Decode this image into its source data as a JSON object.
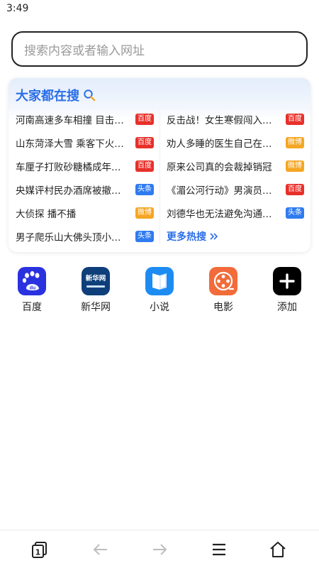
{
  "status_bar": {
    "time": "3:49"
  },
  "search": {
    "placeholder": "搜索内容或者输入网址"
  },
  "hot_search": {
    "title": "大家都在搜",
    "more_label": "更多热搜",
    "left_items": [
      {
        "text": "河南高速多车相撞 目击…",
        "badge": "百度",
        "badge_color": "#e8302a"
      },
      {
        "text": "山东菏泽大雪 乘客下火…",
        "badge": "百度",
        "badge_color": "#e8302a"
      },
      {
        "text": "车厘子打败砂糖橘成年…",
        "badge": "百度",
        "badge_color": "#e8302a"
      },
      {
        "text": "央媒评村民办酒席被撤…",
        "badge": "头条",
        "badge_color": "#2f7bf0"
      },
      {
        "text": "大侦探 播不播",
        "badge": "微博",
        "badge_color": "#f5a623"
      },
      {
        "text": "男子爬乐山大佛头顶小…",
        "badge": "头条",
        "badge_color": "#2f7bf0"
      }
    ],
    "right_items": [
      {
        "text": "反击战！女生寒假闯入…",
        "badge": "百度",
        "badge_color": "#e8302a"
      },
      {
        "text": "劝人多睡的医生自己在…",
        "badge": "微博",
        "badge_color": "#f5a623"
      },
      {
        "text": "原来公司真的会裁掉销冠",
        "badge": "微博",
        "badge_color": "#f5a623"
      },
      {
        "text": "《湄公河行动》男演员…",
        "badge": "百度",
        "badge_color": "#e8302a"
      },
      {
        "text": "刘德华也无法避免沟通…",
        "badge": "头条",
        "badge_color": "#2f7bf0"
      }
    ]
  },
  "shortcuts": [
    {
      "label": "百度",
      "icon": "baidu-icon",
      "color": "#2a32e0"
    },
    {
      "label": "新华网",
      "icon": "xinhua-icon",
      "color": "#0e3f7a",
      "icon_text": "新华网"
    },
    {
      "label": "小说",
      "icon": "book-icon",
      "color": "#1d8cf2"
    },
    {
      "label": "电影",
      "icon": "film-reel-icon",
      "color": "#f26b3a"
    },
    {
      "label": "添加",
      "icon": "add-icon",
      "color": "#000000"
    }
  ],
  "bottom_nav": {
    "tabs_count": "1",
    "items": [
      "tabs-icon",
      "back-arrow-icon",
      "forward-arrow-icon",
      "menu-icon",
      "home-icon"
    ]
  }
}
